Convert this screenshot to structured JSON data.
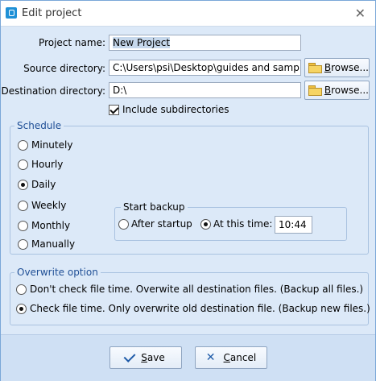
{
  "window": {
    "title": "Edit project",
    "close_glyph": "✕"
  },
  "form": {
    "project_name_label": "Project name:",
    "project_name_value": "New Project",
    "source_label": "Source directory:",
    "source_value": "C:\\Users\\psi\\Desktop\\guides and samples\\E",
    "destination_label": "Destination directory:",
    "destination_value": "D:\\",
    "browse_label_u": "B",
    "browse_label_rest": "rowse...",
    "include_subdirs_label": "Include subdirectories",
    "include_subdirs_checked": true
  },
  "schedule": {
    "title": "Schedule",
    "options": [
      "Minutely",
      "Hourly",
      "Daily",
      "Weekly",
      "Monthly",
      "Manually"
    ],
    "selected": "Daily",
    "start_backup": {
      "title": "Start backup",
      "after_startup_label": "After startup",
      "at_time_label": "At this time:",
      "selected": "At this time",
      "time_value": "10:44"
    }
  },
  "overwrite": {
    "title": "Overwrite option",
    "option1": "Don't check file time. Overwite all destination files. (Backup all files.)",
    "option2": "Check file time. Only overwrite old destination file. (Backup new files.)",
    "selected": "option2"
  },
  "buttons": {
    "save_u": "S",
    "save_rest": "ave",
    "cancel_u": "C",
    "cancel_rest": "ancel"
  }
}
